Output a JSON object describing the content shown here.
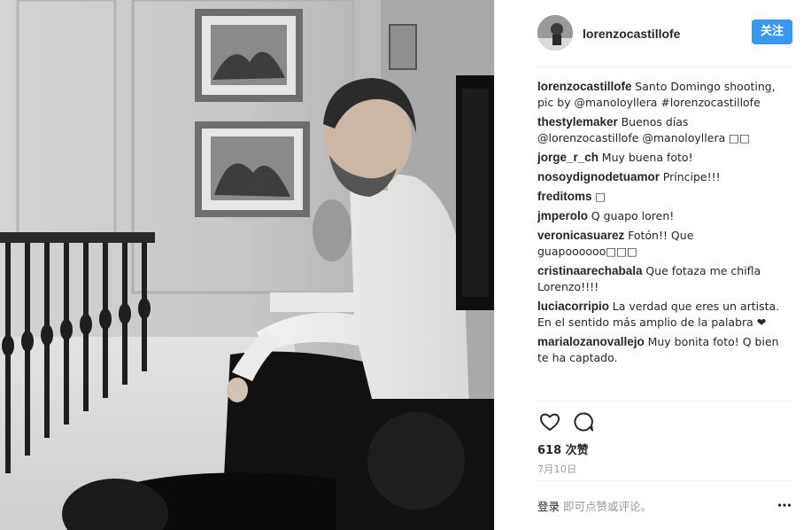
{
  "post": {
    "author": "lorenzocastillofe",
    "follow_label": "关注",
    "caption": {
      "user": "lorenzocastillofe",
      "text": "Santo Domingo shooting, pic by @manoloyllera #lorenzocastillofe"
    }
  },
  "comments": [
    {
      "user": "thestylemaker",
      "text": "Buenos días @lorenzocastillofe @manoloyllera □□"
    },
    {
      "user": "jorge_r_ch",
      "text": "Muy buena foto!"
    },
    {
      "user": "nosoydignodetuamor",
      "text": "Príncipe!!!"
    },
    {
      "user": "freditoms",
      "text": "□"
    },
    {
      "user": "jmperolo",
      "text": "Q guapo loren!"
    },
    {
      "user": "veronicasuarez",
      "text": "Fotón!! Que guapoooooo□□□"
    },
    {
      "user": "cristinaarechabala",
      "text": "Que fotaza me chifla Lorenzo!!!!"
    },
    {
      "user": "luciacorripio",
      "text": "La verdad que eres un artista. En el sentido más amplio de la palabra ❤"
    },
    {
      "user": "marialozanovallejo",
      "text": "Muy bonita foto! Q bien te ha captado."
    }
  ],
  "likes": "618 次赞",
  "date": "7月10日",
  "footer": {
    "login_label": "登录",
    "hint": "即可点赞或评论。"
  },
  "colors": {
    "accent": "#3897f0",
    "text": "#262626",
    "muted": "#999999",
    "divider": "#efefef"
  },
  "icons": {
    "like": "heart-outline-icon",
    "comment": "speech-bubble-icon",
    "more": "ellipsis-icon"
  }
}
